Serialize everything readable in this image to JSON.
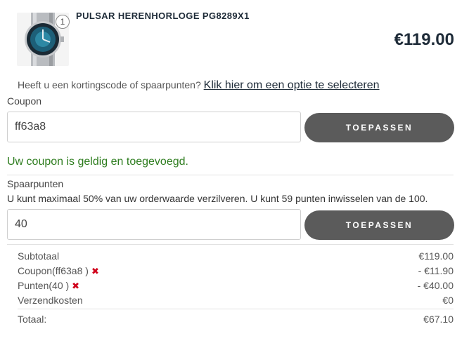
{
  "product": {
    "title": "PULSAR HERENHORLOGE PG8289X1",
    "price": "€119.00",
    "quantity": "1",
    "image_icon": "watch-image"
  },
  "discount": {
    "prompt": "Heeft u een kortingscode of spaarpunten?",
    "link": "Klik hier om een optie te selecteren"
  },
  "coupon": {
    "label": "Coupon",
    "value": "ff63a8",
    "button": "TOEPASSEN",
    "success": "Uw coupon is geldig en toegevoegd."
  },
  "points": {
    "label": "Spaarpunten",
    "info": "U kunt maximaal 50% van uw orderwaarde verzilveren. U kunt 59 punten inwisselen van de 100.",
    "value": "40",
    "button": "TOEPASSEN"
  },
  "summary": {
    "subtotal_label": "Subtotaal",
    "subtotal_value": "€119.00",
    "coupon_label": "Coupon(ff63a8 )",
    "coupon_value": "- €11.90",
    "points_label": "Punten(40 )",
    "points_value": "- €40.00",
    "shipping_label": "Verzendkosten",
    "shipping_value": "€0",
    "total_label": "Totaal:",
    "total_value": "€67.10",
    "remove_glyph": "✖"
  },
  "colors": {
    "button_bg": "#5b5b5b",
    "success_text": "#2e7d1f",
    "remove_icon": "#d0021b",
    "heading": "#1e2b38"
  }
}
